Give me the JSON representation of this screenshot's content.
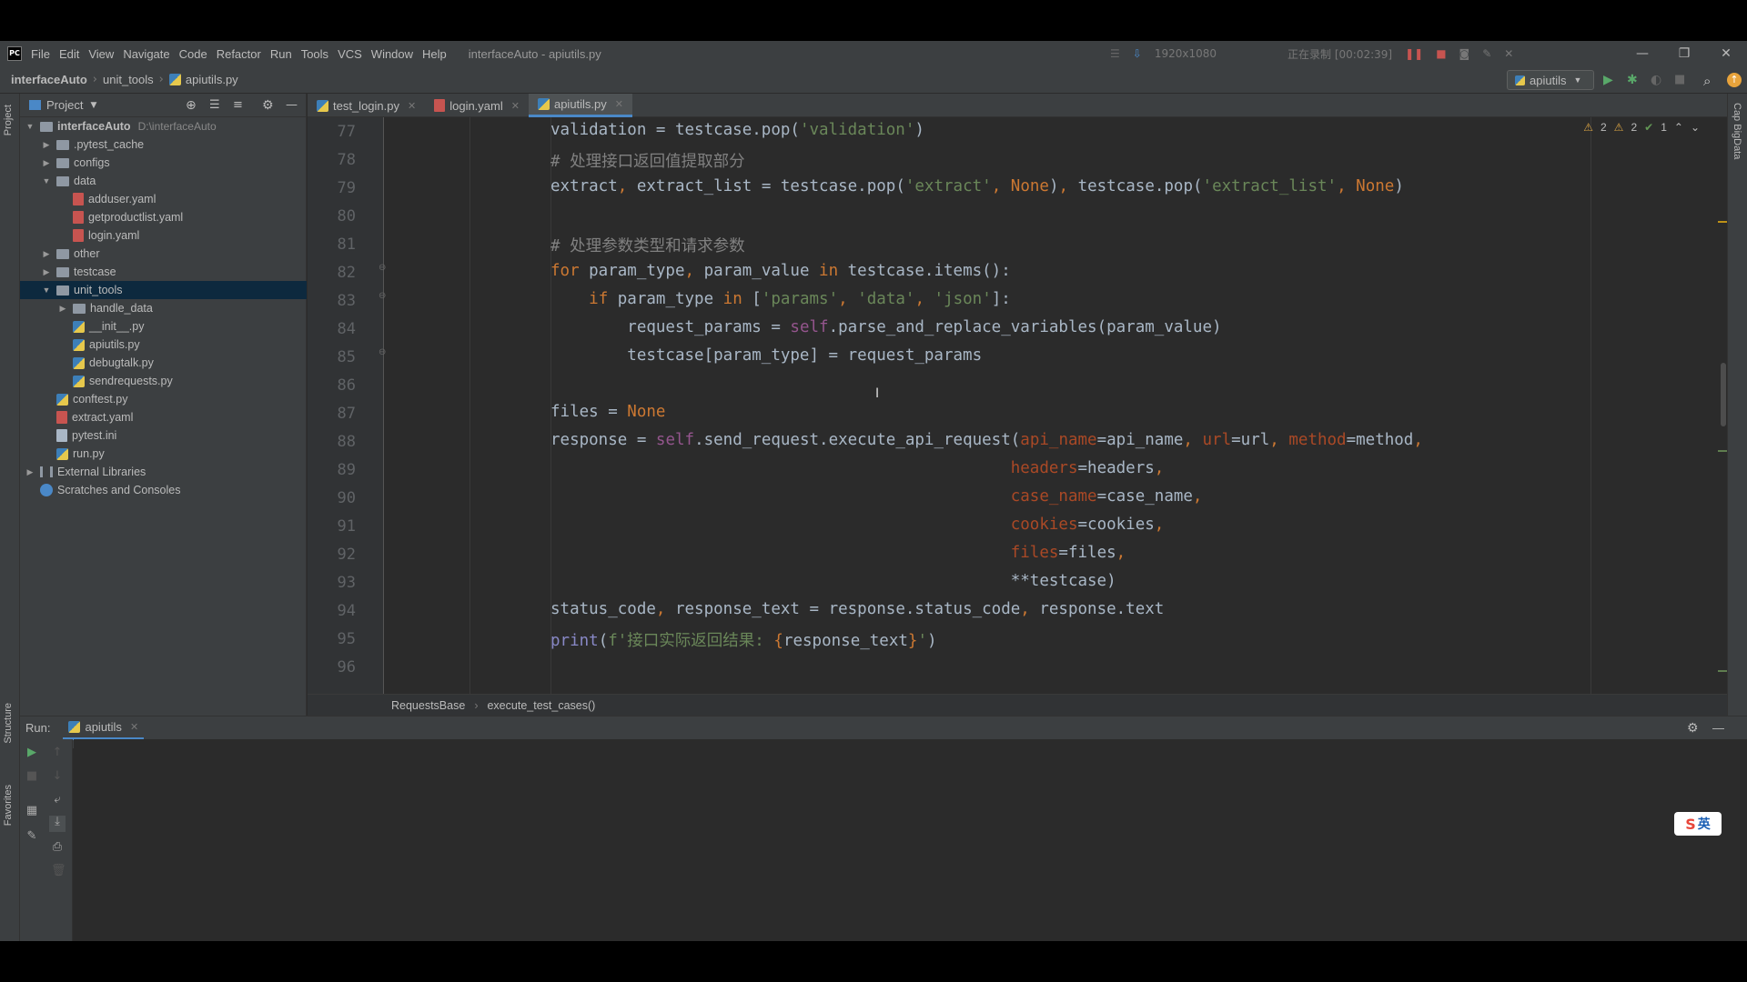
{
  "app": {
    "logo": "PC",
    "window_title": "interfaceAuto - apiutils.py",
    "menu": [
      "File",
      "Edit",
      "View",
      "Navigate",
      "Code",
      "Refactor",
      "Run",
      "Tools",
      "VCS",
      "Window",
      "Help"
    ],
    "recorder": {
      "resolution": "1920x1080",
      "status": "正在录制 [00:02:39]"
    }
  },
  "navbar": {
    "crumbs": [
      "interfaceAuto",
      "unit_tools",
      "apiutils.py"
    ],
    "run_config": "apiutils"
  },
  "stripes": {
    "left": [
      "Project",
      "Structure",
      "Favorites"
    ],
    "right": "Cap BigData"
  },
  "project": {
    "header": "Project",
    "tree": [
      {
        "label": "interfaceAuto",
        "hint": "D:\\interfaceAuto",
        "depth": 0,
        "kind": "folder",
        "expanded": true,
        "bold": true
      },
      {
        "label": ".pytest_cache",
        "depth": 1,
        "kind": "folder",
        "expanded": false
      },
      {
        "label": "configs",
        "depth": 1,
        "kind": "folder",
        "expanded": false
      },
      {
        "label": "data",
        "depth": 1,
        "kind": "folder",
        "expanded": true
      },
      {
        "label": "adduser.yaml",
        "depth": 2,
        "kind": "yaml"
      },
      {
        "label": "getproductlist.yaml",
        "depth": 2,
        "kind": "yaml"
      },
      {
        "label": "login.yaml",
        "depth": 2,
        "kind": "yaml"
      },
      {
        "label": "other",
        "depth": 1,
        "kind": "folder",
        "expanded": false
      },
      {
        "label": "testcase",
        "depth": 1,
        "kind": "folder",
        "expanded": false
      },
      {
        "label": "unit_tools",
        "depth": 1,
        "kind": "folder",
        "expanded": true,
        "selected": true
      },
      {
        "label": "handle_data",
        "depth": 2,
        "kind": "folder",
        "expanded": false
      },
      {
        "label": "__init__.py",
        "depth": 2,
        "kind": "py"
      },
      {
        "label": "apiutils.py",
        "depth": 2,
        "kind": "py"
      },
      {
        "label": "debugtalk.py",
        "depth": 2,
        "kind": "py"
      },
      {
        "label": "sendrequests.py",
        "depth": 2,
        "kind": "py"
      },
      {
        "label": "conftest.py",
        "depth": 1,
        "kind": "py"
      },
      {
        "label": "extract.yaml",
        "depth": 1,
        "kind": "yaml"
      },
      {
        "label": "pytest.ini",
        "depth": 1,
        "kind": "ini"
      },
      {
        "label": "run.py",
        "depth": 1,
        "kind": "py"
      },
      {
        "label": "External Libraries",
        "depth": 0,
        "kind": "lib",
        "expanded": false
      },
      {
        "label": "Scratches and Consoles",
        "depth": 0,
        "kind": "scratch"
      }
    ]
  },
  "tabs": [
    {
      "label": "test_login.py",
      "active": false
    },
    {
      "label": "login.yaml",
      "active": false
    },
    {
      "label": "apiutils.py",
      "active": true
    }
  ],
  "inspections": {
    "warnings_a": "2",
    "warnings_b": "2",
    "ok": "1"
  },
  "code": {
    "line_numbers": [
      "77",
      "78",
      "79",
      "80",
      "81",
      "82",
      "83",
      "84",
      "85",
      "86",
      "87",
      "88",
      "89",
      "90",
      "91",
      "92",
      "93",
      "94",
      "95",
      "96"
    ]
  },
  "code_crumbs": [
    "RequestsBase",
    "execute_test_cases()"
  ],
  "run_panel": {
    "label": "Run:",
    "tab": "apiutils"
  },
  "ime": {
    "label": "英"
  },
  "colors": {
    "keyword": "#cc7832",
    "string": "#6a8759",
    "comment": "#808080",
    "self": "#94558d",
    "param": "#aa4926",
    "selection": "#0d293e",
    "accent": "#4a88c7"
  }
}
